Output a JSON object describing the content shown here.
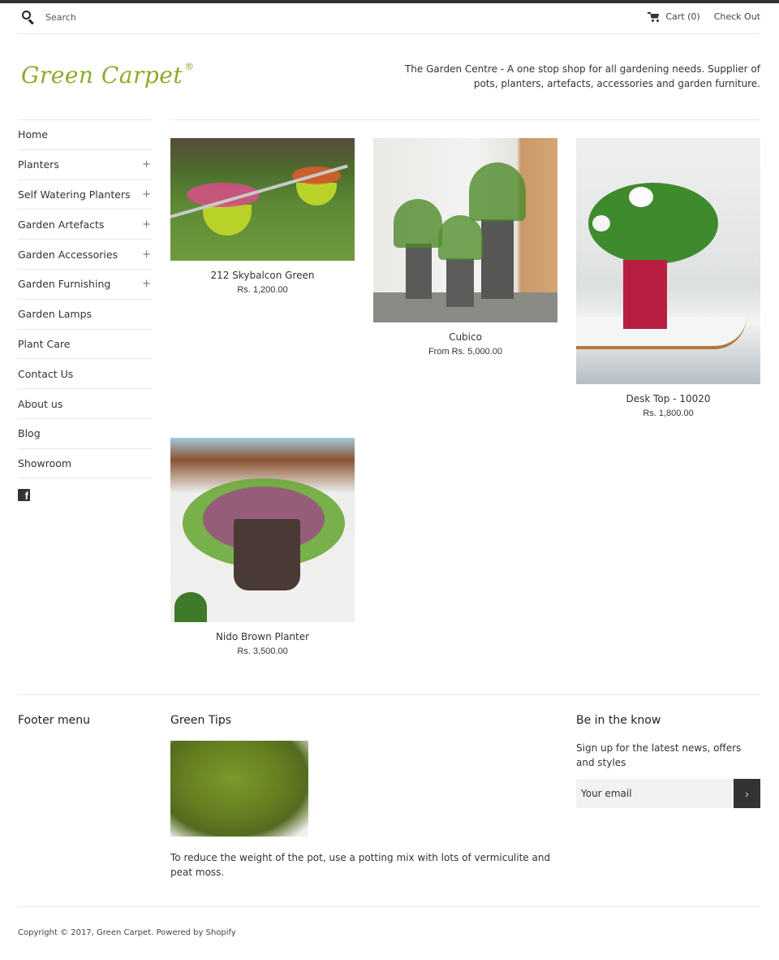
{
  "header": {
    "search_placeholder": "Search",
    "cart_label": "Cart (0)",
    "checkout_label": "Check Out"
  },
  "brand": {
    "logo_text": "Green Carpet",
    "registered_mark": "®",
    "logo_color": "#8bab2a",
    "tagline": "The Garden Centre - A one stop shop for all gardening needs. Supplier of pots, planters, artefacts, accessories and garden furniture."
  },
  "sidebar": {
    "items": [
      {
        "label": "Home",
        "expandable": ""
      },
      {
        "label": "Planters",
        "expandable": "+"
      },
      {
        "label": "Self Watering Planters",
        "expandable": "+"
      },
      {
        "label": "Garden Artefacts",
        "expandable": "+"
      },
      {
        "label": "Garden Accessories",
        "expandable": "+"
      },
      {
        "label": "Garden Furnishing",
        "expandable": "+"
      },
      {
        "label": "Garden Lamps",
        "expandable": ""
      },
      {
        "label": "Plant Care",
        "expandable": ""
      },
      {
        "label": "Contact Us",
        "expandable": ""
      },
      {
        "label": "About us",
        "expandable": ""
      },
      {
        "label": "Blog",
        "expandable": ""
      },
      {
        "label": "Showroom",
        "expandable": ""
      }
    ],
    "social_icon": "facebook-icon",
    "social_glyph": "f"
  },
  "products": [
    {
      "title": "212 Skybalcon Green",
      "price": "Rs. 1,200.00"
    },
    {
      "title": "Cubico",
      "price": "From Rs. 5,000.00"
    },
    {
      "title": "Desk Top - 10020",
      "price": "Rs. 1,800.00"
    },
    {
      "title": "Nido Brown Planter",
      "price": "Rs. 3,500.00"
    }
  ],
  "footer": {
    "menu_heading": "Footer menu",
    "tips_heading": "Green Tips",
    "tips_text": "To reduce the weight of the pot, use a potting mix with lots of vermiculite and peat moss.",
    "newsletter_heading": "Be in the know",
    "newsletter_text": "Sign up for the latest news, offers and styles",
    "email_placeholder": "Your email",
    "submit_glyph": "›",
    "copyright": "Copyright © 2017, Green Carpet. Powered by Shopify"
  }
}
